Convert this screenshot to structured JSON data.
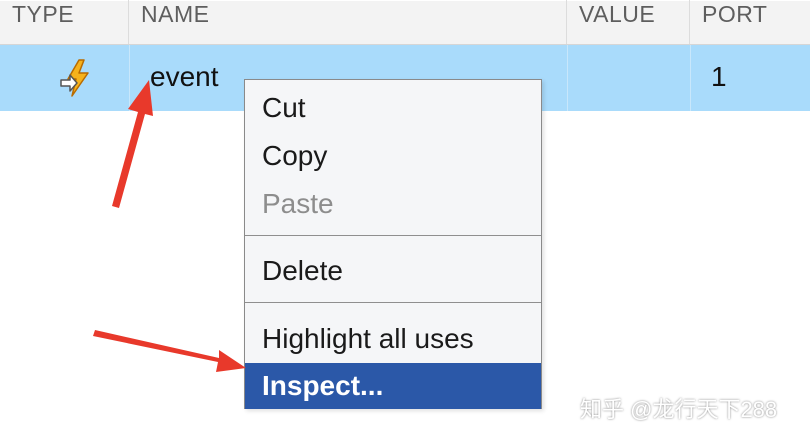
{
  "table": {
    "columns": [
      "TYPE",
      "NAME",
      "VALUE",
      "PORT"
    ],
    "rows": [
      {
        "type_icon": "event-lightning-icon",
        "name": "event",
        "value": "",
        "port": "1"
      }
    ]
  },
  "context_menu": {
    "items": [
      {
        "label": "Cut",
        "state": "enabled"
      },
      {
        "label": "Copy",
        "state": "enabled"
      },
      {
        "label": "Paste",
        "state": "disabled"
      },
      {
        "label": "Delete",
        "state": "enabled"
      },
      {
        "label": "Highlight all uses",
        "state": "enabled"
      },
      {
        "label": "Inspect...",
        "state": "selected"
      }
    ]
  },
  "watermark": "知乎 @龙行天下288",
  "colors": {
    "row_selected": "#a9dbfb",
    "menu_selected": "#2b58a8",
    "arrow": "#e8392b"
  }
}
